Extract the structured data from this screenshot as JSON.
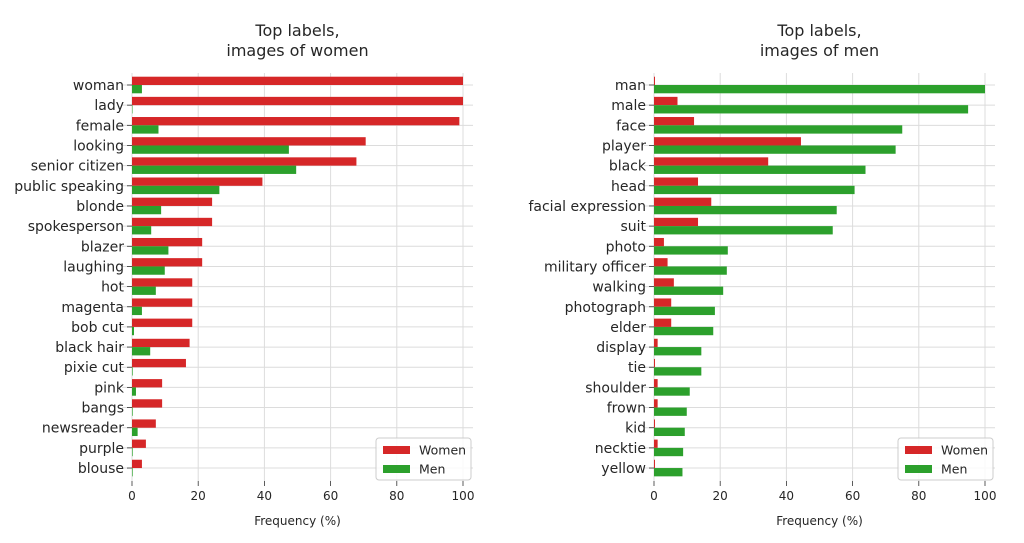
{
  "chart_data": [
    {
      "type": "bar",
      "orientation": "horizontal",
      "title": "Top labels,\nimages of women",
      "xlabel": "Frequency (%)",
      "xlim": [
        0,
        100
      ],
      "xticks": [
        0,
        20,
        40,
        60,
        80,
        100
      ],
      "grid": true,
      "legend_position": "bottom-right",
      "categories": [
        "woman",
        "lady",
        "female",
        "looking",
        "senior citizen",
        "public speaking",
        "blonde",
        "spokesperson",
        "blazer",
        "laughing",
        "hot",
        "magenta",
        "bob cut",
        "black hair",
        "pixie cut",
        "pink",
        "bangs",
        "newsreader",
        "purple",
        "blouse"
      ],
      "series": [
        {
          "name": "Women",
          "color": "#d62728",
          "values": [
            100,
            100,
            98.9,
            70.6,
            67.8,
            39.4,
            24.2,
            24.2,
            21.2,
            21.2,
            18.2,
            18.2,
            18.2,
            17.4,
            16.3,
            9.1,
            9.1,
            7.2,
            4.2,
            3.0
          ]
        },
        {
          "name": "Men",
          "color": "#2ca02c",
          "values": [
            3.0,
            0.1,
            8.0,
            47.4,
            49.6,
            26.4,
            8.8,
            5.8,
            11.0,
            9.9,
            7.2,
            3.0,
            0.6,
            5.5,
            0.2,
            1.2,
            0.2,
            1.7,
            0.2,
            0.2
          ]
        }
      ]
    },
    {
      "type": "bar",
      "orientation": "horizontal",
      "title": "Top labels,\nimages of men",
      "xlabel": "Frequency (%)",
      "xlim": [
        0,
        100
      ],
      "xticks": [
        0,
        20,
        40,
        60,
        80,
        100
      ],
      "grid": true,
      "legend_position": "bottom-right",
      "categories": [
        "man",
        "male",
        "face",
        "player",
        "black",
        "head",
        "facial expression",
        "suit",
        "photo",
        "military officer",
        "walking",
        "photograph",
        "elder",
        "display",
        "tie",
        "shoulder",
        "frown",
        "kid",
        "necktie",
        "yellow"
      ],
      "series": [
        {
          "name": "Women",
          "color": "#d62728",
          "values": [
            0.3,
            7.1,
            12.1,
            44.4,
            34.5,
            13.3,
            17.3,
            13.3,
            3.0,
            4.1,
            6.0,
            5.2,
            5.2,
            1.1,
            0.3,
            1.1,
            1.1,
            0.3,
            1.1,
            0.3
          ]
        },
        {
          "name": "Men",
          "color": "#2ca02c",
          "values": [
            100,
            94.9,
            75.0,
            73.0,
            63.9,
            60.6,
            55.2,
            54.0,
            22.3,
            22.0,
            20.9,
            18.4,
            17.9,
            14.3,
            14.3,
            10.8,
            9.9,
            9.3,
            8.8,
            8.6
          ]
        }
      ]
    }
  ]
}
